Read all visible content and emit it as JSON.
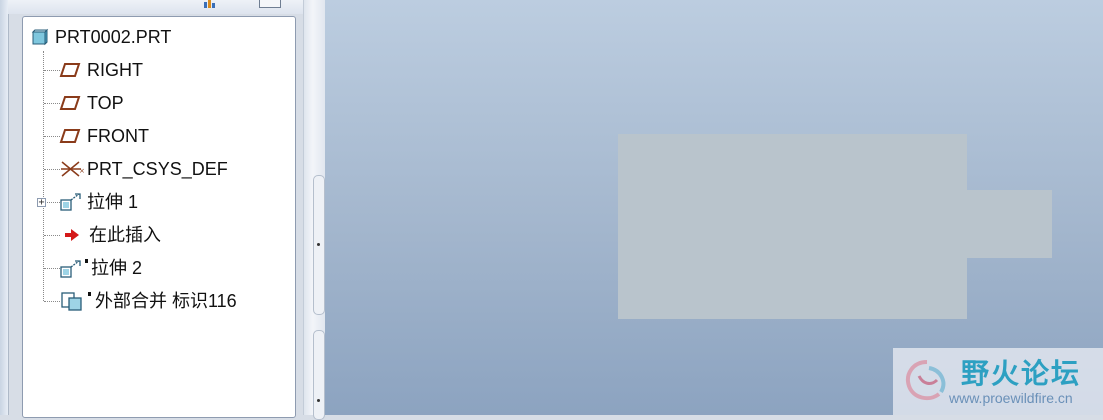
{
  "topbar": {
    "title_partial": ""
  },
  "model_tree": {
    "root": {
      "label": "PRT0002.PRT",
      "icon": "part-icon"
    },
    "items": [
      {
        "label": "RIGHT",
        "icon": "datum-plane-icon"
      },
      {
        "label": "TOP",
        "icon": "datum-plane-icon"
      },
      {
        "label": "FRONT",
        "icon": "datum-plane-icon"
      },
      {
        "label": "PRT_CSYS_DEF",
        "icon": "coordinate-system-icon"
      },
      {
        "label": "拉伸 1",
        "icon": "extrude-icon",
        "expandable": true
      },
      {
        "label": "在此插入",
        "icon": "insert-here-arrow-icon"
      },
      {
        "label": "拉伸 2",
        "icon": "extrude-icon"
      },
      {
        "label": "外部合并 标识116",
        "icon": "external-merge-icon"
      }
    ]
  },
  "colors": {
    "part_fill": "#b9c4cc",
    "insert_arrow": "#d41919",
    "datum_plane": "#8a3b1a",
    "watermark_text": "#2da0c2"
  },
  "watermark": {
    "title": "野火论坛",
    "url": "www.proewildfire.cn"
  }
}
